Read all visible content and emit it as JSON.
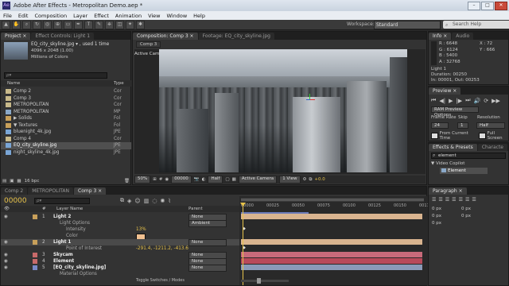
{
  "window": {
    "title": "Adobe After Effects - Metropolitan Demo.aep *",
    "controls": [
      "–",
      "□",
      "✕"
    ]
  },
  "menu": [
    "File",
    "Edit",
    "Composition",
    "Layer",
    "Effect",
    "Animation",
    "View",
    "Window",
    "Help"
  ],
  "toolbar": {
    "workspace_label": "Workspace:",
    "workspace_value": "Standard",
    "search_placeholder": "Search Help"
  },
  "project": {
    "tabs": [
      "Project ×",
      "Effect Controls: Light 1"
    ],
    "preview_name": "EQ_city_skyline.jpg ▾ , used 1 time",
    "preview_dims": "4096 x 2048 (1.00)",
    "preview_colors": "Millions of Colors",
    "search_placeholder": "ρ▾",
    "header_name": "Name",
    "header_type": "Type",
    "items": [
      {
        "name": "Comp 2",
        "type": "Cor",
        "color": "#c8b98a",
        "sel": false
      },
      {
        "name": "Comp 3",
        "type": "Cor",
        "color": "#c8b98a",
        "sel": false
      },
      {
        "name": "METROPOLITAN",
        "type": "Cor",
        "color": "#c8b98a",
        "sel": false
      },
      {
        "name": "METROPOLITAN",
        "type": "MP",
        "color": "#8aa8c8",
        "sel": false
      },
      {
        "name": "▶ Solids",
        "type": "Fol",
        "color": "#c8a05a",
        "sel": false
      },
      {
        "name": "▼ Textures",
        "type": "Fol",
        "color": "#c8a05a",
        "sel": false
      },
      {
        "name": "   bluenight_4k.jpg",
        "type": "JPE",
        "color": "#7aa6d6",
        "sel": false
      },
      {
        "name": "   Comp 4",
        "type": "Cor",
        "color": "#c8b98a",
        "sel": false
      },
      {
        "name": "   EQ_city_skyline.jpg",
        "type": "JPE",
        "color": "#7aa6d6",
        "sel": true
      },
      {
        "name": "   night_skyline_4k.jpg",
        "type": "JPE",
        "color": "#7aa6d6",
        "sel": false
      }
    ],
    "bit_depth": "16 bpc"
  },
  "composition": {
    "tabs": [
      "Composition: Comp 3 ×",
      "Footage: EQ_city_skyline.jpg"
    ],
    "comp_tab": "Comp 3",
    "camera_label": "Active Camera",
    "zoom": "50%",
    "timecode": "00000",
    "resolution": "Half",
    "view": "Active Camera",
    "views": "1 View",
    "exposure": "+0.0"
  },
  "info": {
    "tabs": [
      "Info ×",
      "Audio"
    ],
    "r": "R : 6648",
    "g": "G : 6124",
    "b": "B : 5400",
    "a": "A : 32768",
    "x": "X : 72",
    "y": "Y : 666",
    "layer": "Light 1",
    "duration": "Duration: 00250",
    "in_out": "In: 00001, Out: 00253"
  },
  "preview": {
    "tab": "Preview ×",
    "ram_options": "RAM Preview Options",
    "frame_rate_label": "Frame Rate",
    "skip_label": "Skip",
    "resolution_label": "Resolution",
    "frame_rate": "24",
    "skip": "1",
    "resolution": "Half",
    "from_current": "From Current Time",
    "full_screen": "Full Screen"
  },
  "effects": {
    "tabs": [
      "Effects & Presets ×",
      "Characte"
    ],
    "search": "element",
    "category": "▼ Video Copilot",
    "item": "Element"
  },
  "paragraph": {
    "tab": "Paragraph ×",
    "fields": [
      "0 px",
      "0 px",
      "0 px",
      "0 px",
      "0 px"
    ]
  },
  "timeline": {
    "tabs": [
      "Comp 2",
      "METROPOLITAN",
      "Comp 3 ×"
    ],
    "time": "00000",
    "search_placeholder": "ρ▾",
    "col_num": "#",
    "col_layer": "Layer Name",
    "col_parent": "Parent",
    "ruler": [
      "00000",
      "00025",
      "00050",
      "00075",
      "00100",
      "00125",
      "00150",
      "00175"
    ],
    "toggle": "Toggle Switches / Modes",
    "layers": [
      {
        "num": "1",
        "name": "Light 2",
        "parent": "None",
        "indent": 0,
        "label": "#c8a05a",
        "bar": "#d9b48f",
        "bold": true
      },
      {
        "num": "",
        "name": "Light Options",
        "parent": "Ambient",
        "indent": 1,
        "label": "",
        "bar": "",
        "bold": false
      },
      {
        "num": "",
        "name": "Intensity",
        "parent": "",
        "value": "13%",
        "indent": 2,
        "label": "",
        "bar": "",
        "bold": false
      },
      {
        "num": "",
        "name": "Color",
        "parent": "",
        "value": "swatch",
        "indent": 2,
        "label": "",
        "bar": "",
        "bold": false
      },
      {
        "num": "2",
        "name": "Light 1",
        "parent": "None",
        "indent": 0,
        "label": "#c8a05a",
        "bar": "#d9b48f",
        "bold": true,
        "sel": true
      },
      {
        "num": "",
        "name": "Point of Interest",
        "parent": "",
        "value": "-291.4, -1211.2, -413.6",
        "indent": 2,
        "label": "",
        "bar": "",
        "bold": false
      },
      {
        "num": "3",
        "name": "Skycam",
        "parent": "None",
        "indent": 0,
        "label": "#c86a6a",
        "bar": "#c86a7a",
        "bold": true
      },
      {
        "num": "4",
        "name": "Element",
        "parent": "None",
        "indent": 0,
        "label": "#c86a6a",
        "bar": "#b84a5a",
        "bold": true
      },
      {
        "num": "5",
        "name": "[EQ_city_skyline.jpg]",
        "parent": "None",
        "indent": 0,
        "label": "#7a8ac8",
        "bar": "#8a9ab8",
        "bold": true
      },
      {
        "num": "",
        "name": "Material Options",
        "parent": "",
        "indent": 1,
        "label": "",
        "bar": "",
        "bold": false
      }
    ]
  }
}
